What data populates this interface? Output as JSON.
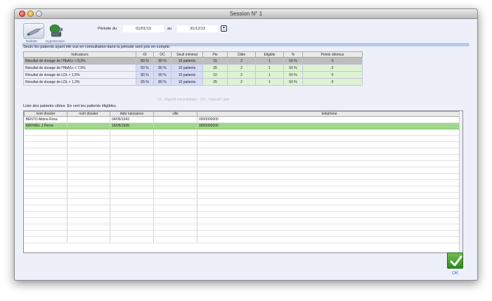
{
  "window": {
    "title": "Session N° 1"
  },
  "toolbar": {
    "diabetes_label": "Diabète",
    "hypertension_label": "Hypertension"
  },
  "period": {
    "label_from": "Période du",
    "from": "01/01/13",
    "label_to": "au",
    "to": "31/12/13"
  },
  "info_text": "Seuls les patients ayant été vus en consultation dans la période sont pris en compte.",
  "indicators": {
    "headers": [
      "Indicateurs",
      "OI",
      "OC",
      "Seuil minimal",
      "Pts",
      "Cible",
      "Eligible",
      "%",
      "Points obtenus"
    ],
    "rows": [
      [
        "Résultat de dosage de l'HbA1c < 8,5%",
        "80 %",
        "90 %",
        "10 patients",
        "15",
        "2",
        "1",
        "50 %",
        "0"
      ],
      [
        "Résultat de dosage de l'HbA1c < 7,5%",
        "60 %",
        "80 %",
        "10 patients",
        "25",
        "2",
        "1",
        "50 %",
        "0"
      ],
      [
        "Résultat de dosage de LDL < 1,5%",
        "80 %",
        "90 %",
        "10 patients",
        "10",
        "2",
        "1",
        "50 %",
        "0"
      ],
      [
        "Résultat de dosage de LDL < 1,3%",
        "65 %",
        "80 %",
        "10 patients",
        "25",
        "2",
        "1",
        "50 %",
        "0"
      ]
    ],
    "selected_row": 0,
    "legend": "OI : Objectif intermédiaire - OC : Objectif Cible"
  },
  "patients": {
    "caption": "Liste des patients cibles. En vert les patients éligibles.",
    "headers": [
      "nom dossier",
      "num dossier",
      "date naissance",
      "ville",
      "telephone"
    ],
    "rows": [
      {
        "values": [
          "BENTO Albina Rosa",
          "",
          "04/06/1943",
          "",
          "0000000000"
        ],
        "eligible": false
      },
      {
        "values": [
          "WAYMEL J Pierre",
          "",
          "16/05/1935",
          "",
          "0000000000"
        ],
        "eligible": true
      }
    ],
    "eligible_color": "#9fd88a"
  },
  "ok": {
    "label": "OK"
  },
  "colors": {
    "accent_blue": "#b9c8e8",
    "indicator_blue": "#d7dcf7",
    "indicator_green": "#ddf3d4"
  }
}
